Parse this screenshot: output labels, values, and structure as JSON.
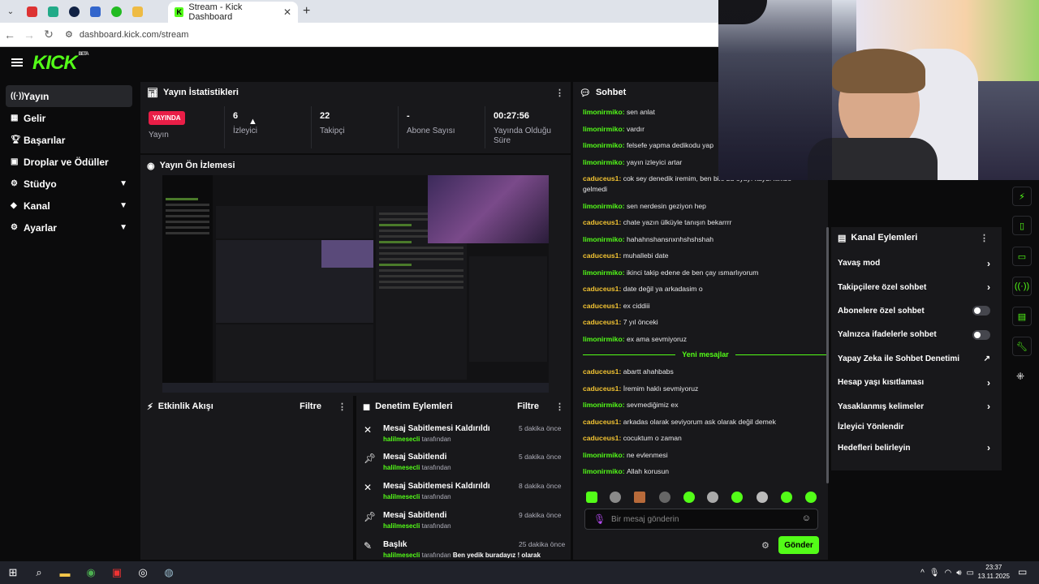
{
  "browser": {
    "tab_title": "Stream - Kick Dashboard",
    "url": "dashboard.kick.com/stream"
  },
  "brand": {
    "logo": "KICK",
    "tag": "BETA",
    "accent": "#53fc18"
  },
  "sidebar": {
    "items": [
      {
        "label": "Yayın",
        "icon": "broadcast-icon",
        "active": true
      },
      {
        "label": "Gelir",
        "icon": "dashboard-icon"
      },
      {
        "label": "Başarılar",
        "icon": "trophy-icon"
      },
      {
        "label": "Droplar ve Ödüller",
        "icon": "gift-icon"
      },
      {
        "label": "Stüdyo",
        "icon": "studio-icon",
        "expandable": true
      },
      {
        "label": "Kanal",
        "icon": "chat-icon",
        "expandable": true
      },
      {
        "label": "Ayarlar",
        "icon": "gear-icon",
        "expandable": true
      }
    ]
  },
  "stats": {
    "title": "Yayın İstatistikleri",
    "live_badge": "YAYINDA",
    "live_label": "Yayın",
    "viewers": "6",
    "viewers_label": "İzleyici",
    "followers": "22",
    "followers_label": "Takipçi",
    "subs": "-",
    "subs_label": "Abone Sayısı",
    "uptime": "00:27:56",
    "uptime_label": "Yayında Olduğu Süre"
  },
  "preview": {
    "title": "Yayın Ön İzlemesi"
  },
  "activity": {
    "title": "Etkinlik Akışı",
    "filter": "Filtre"
  },
  "moderation": {
    "title": "Denetim Eylemleri",
    "filter": "Filtre",
    "items": [
      {
        "action": "Mesaj Sabitlemesi Kaldırıldı",
        "user": "halilmesecli",
        "by": "tarafından",
        "time": "5 dakika önce",
        "icon": "unpin-icon"
      },
      {
        "action": "Mesaj Sabitlendi",
        "user": "halilmesecli",
        "by": "tarafından",
        "time": "5 dakika önce",
        "icon": "pin-icon"
      },
      {
        "action": "Mesaj Sabitlemesi Kaldırıldı",
        "user": "halilmesecli",
        "by": "tarafından",
        "time": "8 dakika önce",
        "icon": "unpin-icon"
      },
      {
        "action": "Mesaj Sabitlendi",
        "user": "halilmesecli",
        "by": "tarafından",
        "time": "9 dakika önce",
        "icon": "pin-icon"
      },
      {
        "action": "Başlık",
        "user": "halilmesecli",
        "by": "tarafından",
        "time": "25 dakika önce",
        "icon": "title-icon",
        "extra": "Ben yedik buradayız ! olarak"
      }
    ]
  },
  "chat": {
    "title": "Sohbet",
    "new_messages": "Yeni mesajlar",
    "placeholder": "Bir mesaj gönderin",
    "send": "Gönder",
    "messages": [
      {
        "user": "limonirmiko",
        "text": "sen anlat"
      },
      {
        "user": "limonirmiko",
        "text": "vardır"
      },
      {
        "user": "limonirmiko",
        "text": "felsefe yapma dedikodu yap"
      },
      {
        "user": "limonirmiko",
        "text": "yayın izleyici artar"
      },
      {
        "user": "caduceus1",
        "text": "cok sey denedik iremim, ben bile bu oyayı kaydı kimse gelmedi"
      },
      {
        "user": "limonirmiko",
        "text": "sen nerdesin geziyon hep"
      },
      {
        "user": "caduceus1",
        "text": "chate yazın ülküyle tanışın bekarrrr"
      },
      {
        "user": "limonirmiko",
        "text": "hahahnshansnxnhshshshah"
      },
      {
        "user": "caduceus1",
        "text": "muhallebi date"
      },
      {
        "user": "limonirmiko",
        "text": "ikinci takip edene de ben çay ısmarlıyorum"
      },
      {
        "user": "caduceus1",
        "text": "date değil ya arkadasim o"
      },
      {
        "user": "caduceus1",
        "text": "ex ciddiii"
      },
      {
        "user": "caduceus1",
        "text": "7 yıl önceki"
      },
      {
        "user": "limonirmiko",
        "text": "ex ama sevmiyoruz"
      }
    ],
    "messages_new": [
      {
        "user": "caduceus1",
        "text": "abartt ahahbabs"
      },
      {
        "user": "caduceus1",
        "text": "İremim haklı sevmiyoruz"
      },
      {
        "user": "limonirmiko",
        "text": "sevmediğimiz ex"
      },
      {
        "user": "caduceus1",
        "text": "arkadas olarak seviyorum ask olarak değil demek"
      },
      {
        "user": "caduceus1",
        "text": "cocuktum o zaman"
      },
      {
        "user": "limonirmiko",
        "text": "ne evlenmesi"
      },
      {
        "user": "limonirmiko",
        "text": "Allah korusun"
      }
    ]
  },
  "channel_actions": {
    "title": "Kanal Eylemleri",
    "items": [
      {
        "label": "Yavaş mod",
        "control": "chevron"
      },
      {
        "label": "Takipçilere özel sohbet",
        "control": "chevron"
      },
      {
        "label": "Abonelere özel sohbet",
        "control": "toggle"
      },
      {
        "label": "Yalnızca ifadelerle sohbet",
        "control": "toggle"
      },
      {
        "label": "Yapay Zeka ile Sohbet Denetimi",
        "control": "external"
      },
      {
        "label": "Hesap yaşı kısıtlaması",
        "control": "chevron"
      },
      {
        "label": "Yasaklanmış kelimeler",
        "control": "chevron"
      },
      {
        "label": "İzleyici Yönlendir",
        "control": "none"
      },
      {
        "label": "Hedefleri belirleyin",
        "control": "chevron"
      }
    ]
  },
  "taskbar": {
    "time": "23:37",
    "date": "13.11.2025"
  }
}
